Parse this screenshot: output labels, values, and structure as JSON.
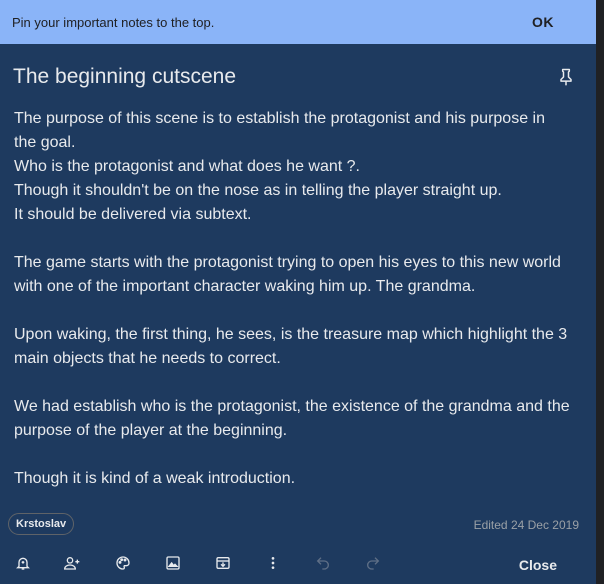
{
  "banner": {
    "text": "Pin your important notes to the top.",
    "ok_label": "OK"
  },
  "note": {
    "title": "The beginning cutscene",
    "paragraphs": [
      [
        "The purpose of this scene is to establish the protagonist and his purpose in",
        "the goal.",
        "Who is the protagonist and what does he want ?.",
        "Though it shouldn't be on the nose as in telling the player straight up.",
        "It should be delivered via subtext."
      ],
      [
        "The game starts with the protagonist trying to open his eyes to this new world",
        "with one of the important character waking him up. The grandma."
      ],
      [
        "Upon waking, the first thing, he sees, is the treasure map which highlight the 3",
        "main objects that he needs to correct."
      ],
      [
        "We had establish who is the protagonist, the existence of the grandma and the",
        "purpose of the player at the beginning."
      ],
      [
        "Though it is kind of a weak introduction."
      ]
    ],
    "label": "Krstoslav",
    "edited": "Edited 24 Dec 2019"
  },
  "toolbar": {
    "icons": [
      "reminder-icon",
      "collaborator-icon",
      "palette-icon",
      "image-icon",
      "archive-icon",
      "more-icon",
      "undo-icon",
      "redo-icon"
    ],
    "close_label": "Close"
  },
  "colors": {
    "banner": "#8ab4f8",
    "note_bg": "#1e3a5f",
    "text": "#e8eaed",
    "muted": "#9aa0a6"
  }
}
